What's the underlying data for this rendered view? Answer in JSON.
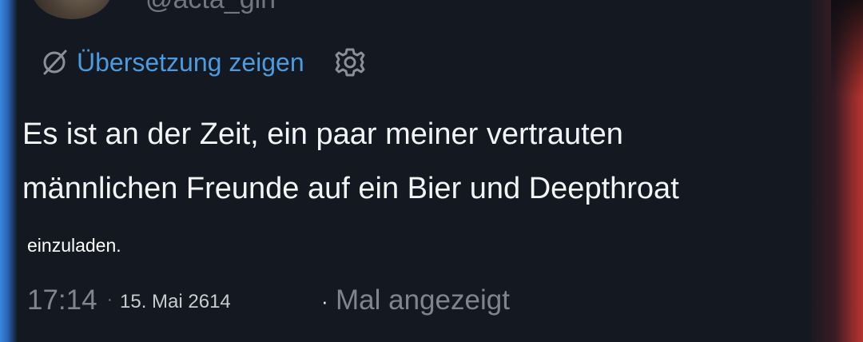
{
  "header": {
    "handle": "@acta_gin"
  },
  "translate": {
    "label": "Übersetzung zeigen",
    "icon": "no-translate-icon",
    "settings_icon": "gear-icon"
  },
  "tweet": {
    "line1": "Es ist an der Zeit, ein paar meiner vertrauten",
    "line2": "männlichen Freunde auf ein Bier und Deepthroat",
    "line3": "einzuladen."
  },
  "meta": {
    "time": "17:14",
    "separator": "·",
    "date": "15. Mai 2614",
    "views": "Mal angezeigt"
  },
  "colors": {
    "background": "#141820",
    "link": "#4a9be0",
    "text": "#f2f4f6",
    "muted": "#7d858f"
  }
}
